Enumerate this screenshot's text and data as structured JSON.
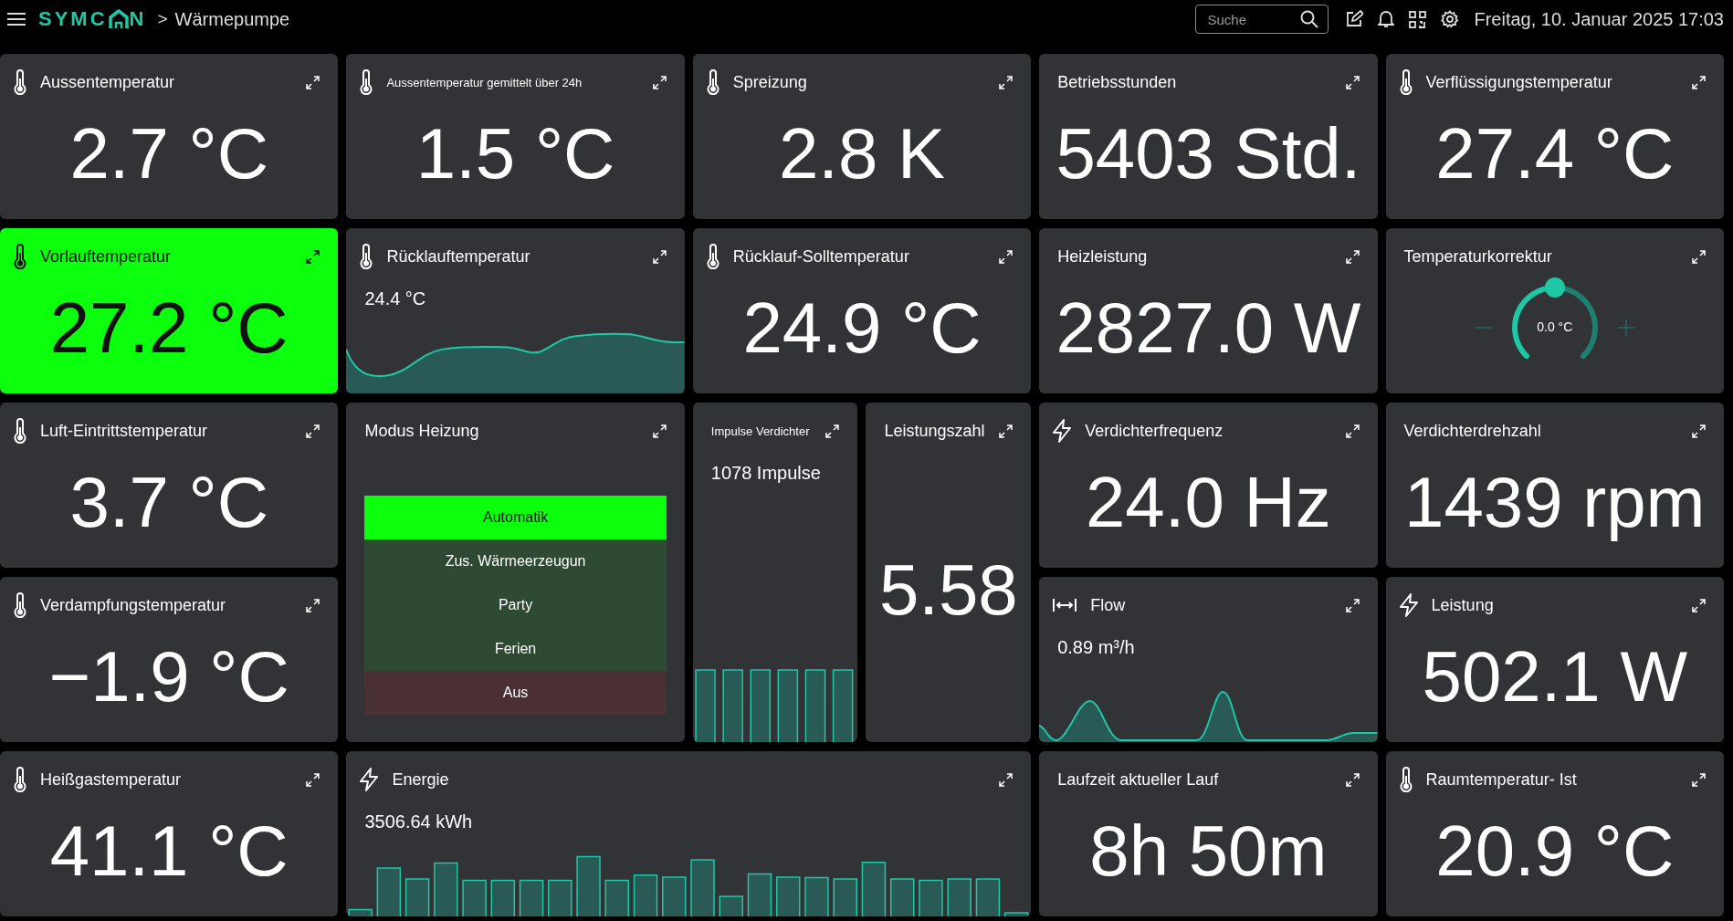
{
  "header": {
    "logo_start": "SYMC",
    "logo_end": "N",
    "separator": ">",
    "breadcrumb": "Wärmepumpe",
    "search": {
      "placeholder": "Suche"
    },
    "datetime": "Freitag, 10. Januar 2025 17:03"
  },
  "tiles": [
    {
      "kind": "value",
      "title": "Aussentemperatur",
      "compact": false,
      "highlighted": false,
      "value": "2.7 °C"
    },
    {
      "kind": "value",
      "title": "Aussentemperatur gemittelt über 24h",
      "compact": true,
      "highlighted": false,
      "value": "1.5 °C"
    },
    {
      "kind": "value",
      "title": "Spreizung",
      "compact": false,
      "highlighted": false,
      "value": "2.8 K"
    },
    {
      "kind": "value",
      "title": "Betriebsstunden",
      "compact": false,
      "highlighted": false,
      "value": "5403 Std."
    },
    {
      "kind": "value",
      "title": "Verflüssigungstemperatur",
      "compact": false,
      "highlighted": false,
      "value": "27.4 °C"
    },
    {
      "kind": "value",
      "title": "Vorlauftemperatur",
      "compact": false,
      "highlighted": true,
      "value": "27.2 °C"
    },
    {
      "kind": "area",
      "title": "Rücklauftemperatur",
      "compact": false,
      "highlighted": false,
      "value": "24.4 °C"
    },
    {
      "kind": "value",
      "title": "Rücklauf-Solltemperatur",
      "compact": false,
      "highlighted": false,
      "value": "24.9 °C"
    },
    {
      "kind": "value",
      "title": "Heizleistung",
      "compact": false,
      "highlighted": false,
      "value": "2827.0 W"
    },
    {
      "kind": "knob",
      "title": "Temperaturkorrektur",
      "compact": false,
      "highlighted": false,
      "value": "0.0 °C",
      "level": 0.5
    },
    {
      "kind": "value",
      "title": "Luft-Eintrittstemperatur",
      "compact": false,
      "highlighted": false,
      "value": "3.7 °C"
    },
    {
      "kind": "modes",
      "title": "Modus Heizung",
      "compact": false,
      "highlighted": false,
      "options": [
        {
          "label": "Automatik",
          "kind": "mode",
          "selected": true
        },
        {
          "label": "Zus. Wärmeerzeugun",
          "kind": "mode",
          "selected": false
        },
        {
          "label": "Party",
          "kind": "mode",
          "selected": false
        },
        {
          "label": "Ferien",
          "kind": "mode",
          "selected": false
        },
        {
          "label": "Aus",
          "kind": "off",
          "selected": false
        }
      ]
    },
    {
      "kind": "bars",
      "title": "Impulse Verdichter",
      "compact": true,
      "highlighted": false,
      "value": "1078 Impulse"
    },
    {
      "kind": "value",
      "title": "Leistungszahl",
      "compact": false,
      "highlighted": false,
      "value": "5.58"
    },
    {
      "kind": "value",
      "title": "Verdichterfrequenz",
      "compact": false,
      "highlighted": false,
      "value": "24.0 Hz"
    },
    {
      "kind": "value",
      "title": "Verdichterdrehzahl",
      "compact": false,
      "highlighted": false,
      "value": "1439 rpm"
    },
    {
      "kind": "value",
      "title": "Verdampfungstemperatur",
      "compact": false,
      "highlighted": false,
      "value": "−1.9 °C"
    },
    {
      "kind": "area",
      "title": "Flow",
      "compact": false,
      "highlighted": false,
      "value": "0.89 m³/h"
    },
    {
      "kind": "value",
      "title": "Leistung",
      "compact": false,
      "highlighted": false,
      "value": "502.1 W"
    },
    {
      "kind": "value",
      "title": "Heißgastemperatur",
      "compact": false,
      "highlighted": false,
      "value": "41.1 °C"
    },
    {
      "kind": "bars",
      "title": "Energie",
      "compact": false,
      "highlighted": false,
      "value": "3506.64 kWh"
    },
    {
      "kind": "value",
      "title": "Laufzeit aktueller Lauf",
      "compact": false,
      "highlighted": false,
      "value": "8h 50m"
    },
    {
      "kind": "value",
      "title": "Raumtemperatur- Ist",
      "compact": false,
      "highlighted": false,
      "value": "20.9 °C"
    }
  ]
}
